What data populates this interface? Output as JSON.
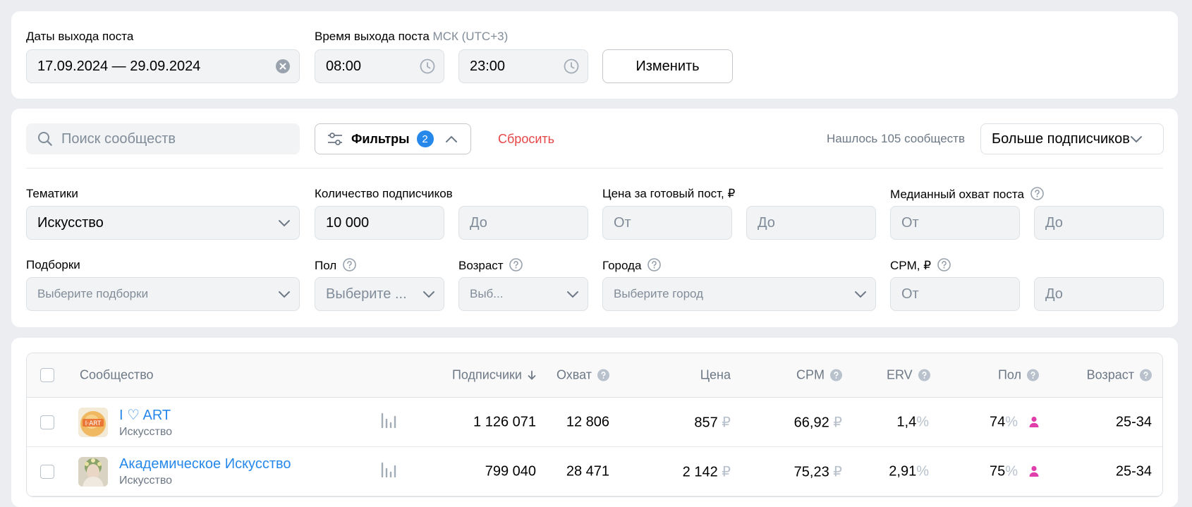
{
  "dates": {
    "label": "Даты выхода поста",
    "value": "17.09.2024 — 29.09.2024"
  },
  "time": {
    "label": "Время выхода поста",
    "tz": "МСК (UTC+3)",
    "from": "08:00",
    "to": "23:00"
  },
  "change_button": "Изменить",
  "search": {
    "placeholder": "Поиск сообществ"
  },
  "filters": {
    "label": "Фильтры",
    "count": "2"
  },
  "reset": "Сбросить",
  "found": "Нашлось 105 сообществ",
  "sort": {
    "value": "Больше подписчиков"
  },
  "themes": {
    "label": "Тематики",
    "value": "Искусство"
  },
  "subscribers": {
    "label": "Количество подписчиков",
    "from": "10 000",
    "to_placeholder": "До"
  },
  "price": {
    "label": "Цена за готовый пост, ₽",
    "from_placeholder": "От",
    "to_placeholder": "До"
  },
  "reach": {
    "label": "Медианный охват поста",
    "from_placeholder": "От",
    "to_placeholder": "До"
  },
  "collections": {
    "label": "Подборки",
    "placeholder": "Выберите подборки"
  },
  "gender": {
    "label": "Пол",
    "placeholder": "Выберите ..."
  },
  "age": {
    "label": "Возраст",
    "placeholder": "Выб..."
  },
  "cities": {
    "label": "Города",
    "placeholder": "Выберите город"
  },
  "cpm_filter": {
    "label": "CPM, ₽",
    "from_placeholder": "От",
    "to_placeholder": "До"
  },
  "table": {
    "headers": {
      "community": "Сообщество",
      "subscribers": "Подписчики",
      "reach": "Охват",
      "price": "Цена",
      "cpm": "CPM",
      "erv": "ERV",
      "gender": "Пол",
      "age": "Возраст"
    },
    "rows": [
      {
        "name": "I ♡ ART",
        "category": "Искусство",
        "subscribers": "1 126 071",
        "reach": "12 806",
        "price": "857",
        "cpm": "66,92",
        "erv": "1,4",
        "gender": "74",
        "age": "25-34"
      },
      {
        "name": "Академическое Искусство",
        "category": "Искусство",
        "subscribers": "799 040",
        "reach": "28 471",
        "price": "2 142",
        "cpm": "75,23",
        "erv": "2,91",
        "gender": "75",
        "age": "25-34"
      }
    ],
    "currency": "₽",
    "percent": "%"
  },
  "colors": {
    "accent": "#2688eb",
    "danger": "#e64646",
    "female": "#e03fab",
    "bg": "#ebedf0"
  }
}
